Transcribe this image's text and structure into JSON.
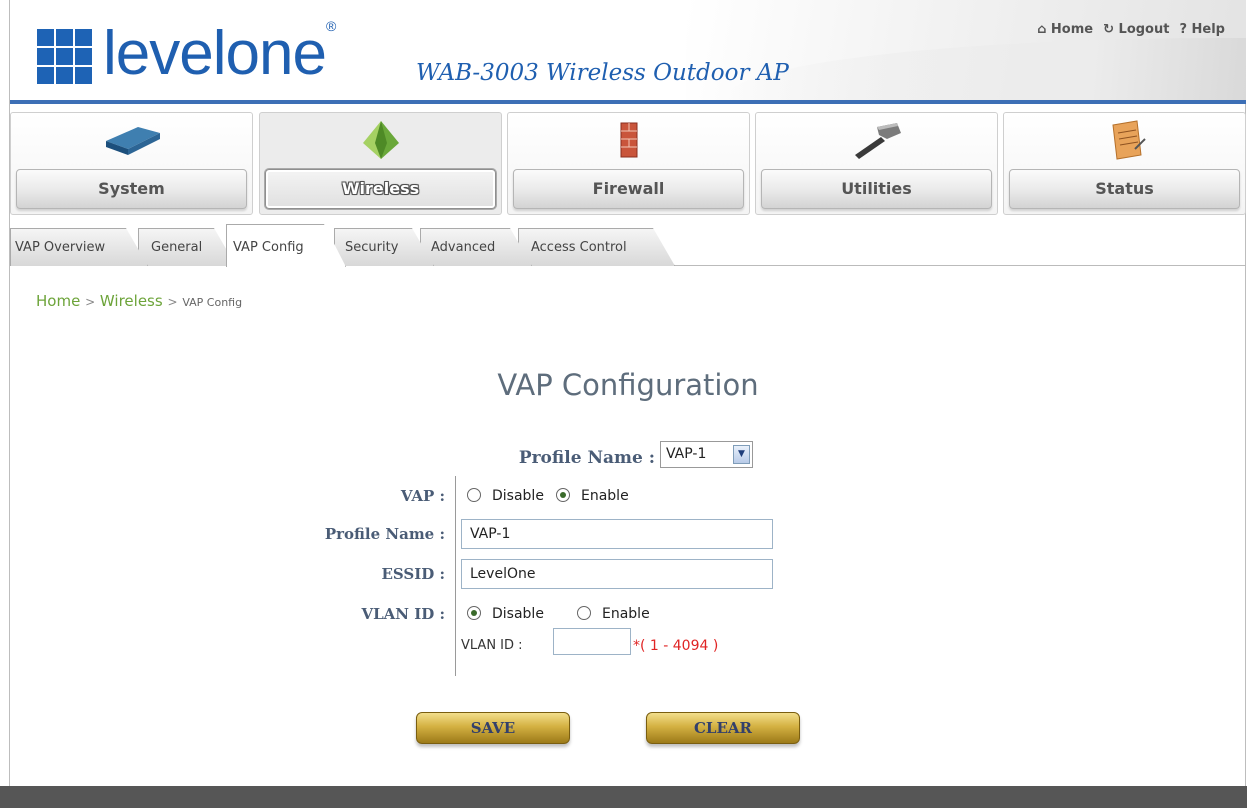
{
  "header": {
    "brand": "levelone",
    "model": "WAB-3003 Wireless Outdoor AP",
    "links": {
      "home": "Home",
      "logout": "Logout",
      "help": "Help"
    }
  },
  "nav": [
    {
      "label": "System",
      "icon": "router-icon"
    },
    {
      "label": "Wireless",
      "icon": "wireless-icon",
      "active": true
    },
    {
      "label": "Firewall",
      "icon": "firewall-icon"
    },
    {
      "label": "Utilities",
      "icon": "hammer-icon"
    },
    {
      "label": "Status",
      "icon": "notepad-icon"
    }
  ],
  "tabs": [
    {
      "label": "VAP Overview"
    },
    {
      "label": "General"
    },
    {
      "label": "VAP Config",
      "active": true
    },
    {
      "label": "Security"
    },
    {
      "label": "Advanced"
    },
    {
      "label": "Access Control"
    }
  ],
  "breadcrumb": {
    "home": "Home",
    "sep": ">",
    "section": "Wireless",
    "current": "VAP Config"
  },
  "page_title": "VAP Configuration",
  "form": {
    "profile_select_label": "Profile Name :",
    "profile_select_value": "VAP-1",
    "vap_label": "VAP :",
    "vap_disable": "Disable",
    "vap_enable": "Enable",
    "vap_value": "Enable",
    "profile_name_label": "Profile Name :",
    "profile_name_value": "VAP-1",
    "essid_label": "ESSID :",
    "essid_value": "LevelOne",
    "vlan_label": "VLAN ID :",
    "vlan_disable": "Disable",
    "vlan_enable": "Enable",
    "vlan_value": "Disable",
    "vlan_id_label": "VLAN ID :",
    "vlan_id_value": "",
    "vlan_range": "*( 1 - 4094 )"
  },
  "buttons": {
    "save": "SAVE",
    "clear": "CLEAR"
  },
  "colors": {
    "brand_blue": "#1f5fb0",
    "breadcrumb_green": "#6da43a",
    "required_red": "#e02424",
    "button_gold": "#d4b142"
  }
}
